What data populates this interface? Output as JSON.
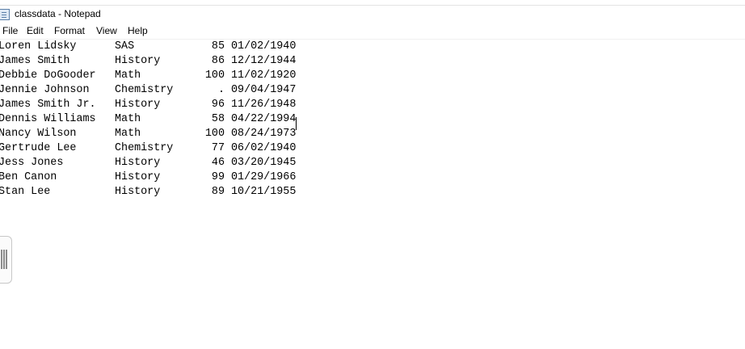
{
  "window": {
    "title": "classdata - Notepad",
    "icon": "notepad-icon"
  },
  "menu": [
    {
      "label": "File"
    },
    {
      "label": "Edit"
    },
    {
      "label": "Format"
    },
    {
      "label": "View"
    },
    {
      "label": "Help"
    }
  ],
  "document": {
    "rows": [
      {
        "name": "Loren Lidsky",
        "subject": "SAS",
        "score": "85",
        "date": "01/02/1940"
      },
      {
        "name": "James Smith",
        "subject": "History",
        "score": "86",
        "date": "12/12/1944"
      },
      {
        "name": "Debbie DoGooder",
        "subject": "Math",
        "score": "100",
        "date": "11/02/1920"
      },
      {
        "name": "Jennie Johnson",
        "subject": "Chemistry",
        "score": ".",
        "date": "09/04/1947"
      },
      {
        "name": "James Smith Jr.",
        "subject": "History",
        "score": "96",
        "date": "11/26/1948"
      },
      {
        "name": "Dennis Williams",
        "subject": "Math",
        "score": "58",
        "date": "04/22/1994"
      },
      {
        "name": "Nancy Wilson",
        "subject": "Math",
        "score": "100",
        "date": "08/24/1973"
      },
      {
        "name": "Gertrude Lee",
        "subject": "Chemistry",
        "score": "77",
        "date": "06/02/1940"
      },
      {
        "name": "Jess Jones",
        "subject": "History",
        "score": "46",
        "date": "03/20/1945"
      },
      {
        "name": "Ben Canon",
        "subject": "History",
        "score": "99",
        "date": "01/29/1966"
      },
      {
        "name": "Stan Lee",
        "subject": "History",
        "score": "89",
        "date": "10/21/1955"
      }
    ]
  },
  "side_panel": {
    "icon": "panel-handle-icon"
  }
}
